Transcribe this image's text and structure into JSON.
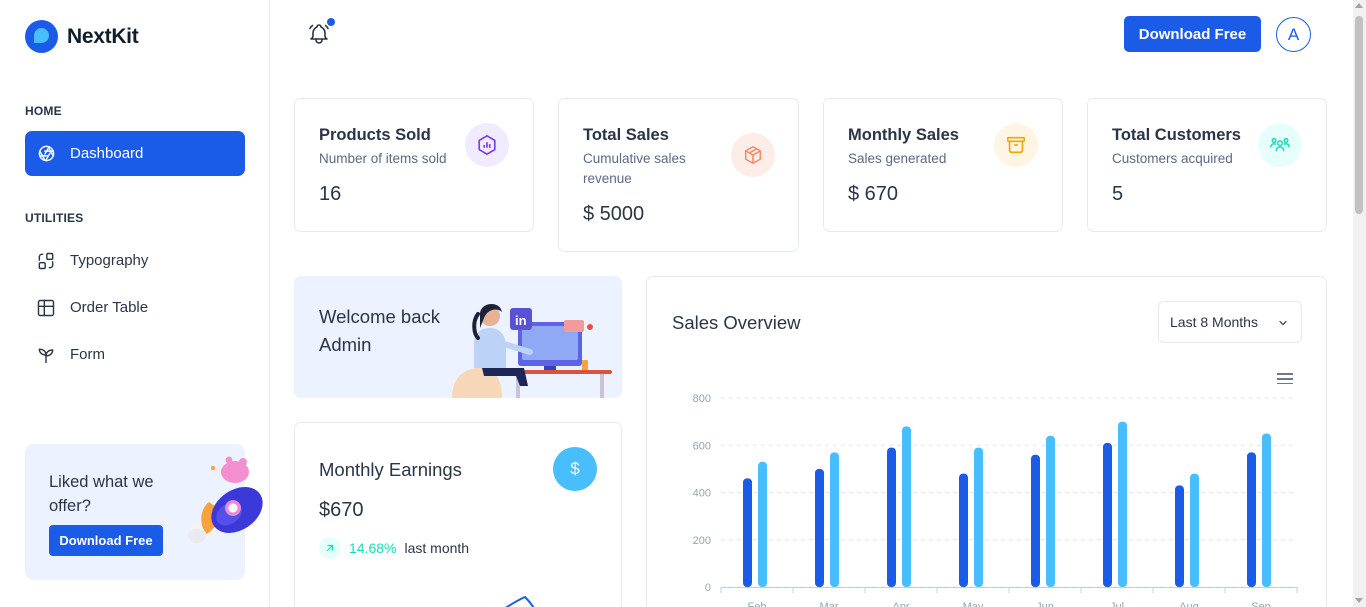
{
  "brand": {
    "name": "NextKit"
  },
  "sidebar": {
    "sections": [
      {
        "caption": "HOME",
        "items": [
          {
            "label": "Dashboard",
            "icon": "aperture-icon",
            "active": true
          }
        ]
      },
      {
        "caption": "UTILITIES",
        "items": [
          {
            "label": "Typography",
            "icon": "typography-icon"
          },
          {
            "label": "Order Table",
            "icon": "table-icon"
          },
          {
            "label": "Form",
            "icon": "plant-icon"
          }
        ]
      }
    ],
    "promo": {
      "title": "Liked what we offer?",
      "button": "Download Free"
    }
  },
  "header": {
    "download_button": "Download Free",
    "avatar_initial": "A",
    "notification_icon": "bell-icon"
  },
  "stats": [
    {
      "title": "Products Sold",
      "subtitle": "Number of items sold",
      "value": "16",
      "icon": "chart-bar-icon",
      "icon_color": "#7c3aed",
      "icon_bg": "#f1ebff"
    },
    {
      "title": "Total Sales",
      "subtitle": "Cumulative sales revenue",
      "value": "$ 5000",
      "icon": "box-icon",
      "icon_color": "#fa896b",
      "icon_bg": "#fdede8"
    },
    {
      "title": "Monthly Sales",
      "subtitle": "Sales generated",
      "value": "$ 670",
      "icon": "archive-icon",
      "icon_color": "#f0a500",
      "icon_bg": "#fef5e5"
    },
    {
      "title": "Total Customers",
      "subtitle": "Customers acquired",
      "value": "5",
      "icon": "users-icon",
      "icon_color": "#13deb9",
      "icon_bg": "#e6fffa"
    }
  ],
  "welcome": {
    "text": "Welcome back Admin"
  },
  "earnings": {
    "title": "Monthly Earnings",
    "value": "$670",
    "change": "14.68%",
    "period": "last month",
    "icon": "dollar-icon"
  },
  "sales_overview": {
    "title": "Sales Overview",
    "selected_range": "Last 8 Months",
    "menu_icon": "hamburger-menu-icon"
  },
  "colors": {
    "primary": "#1a5be8",
    "secondary": "#49beff",
    "success": "#13deb9"
  },
  "chart_data": {
    "type": "bar",
    "categories": [
      "Feb",
      "Mar",
      "Apr",
      "May",
      "Jun",
      "Jul",
      "Aug",
      "Sep"
    ],
    "series": [
      {
        "values": [
          460,
          500,
          590,
          480,
          560,
          610,
          430,
          570
        ],
        "color": "#1a5be8"
      },
      {
        "values": [
          530,
          570,
          680,
          590,
          640,
          700,
          480,
          650
        ],
        "color": "#49beff"
      }
    ],
    "yticks": [
      0,
      200,
      400,
      600,
      800
    ],
    "ylim": [
      0,
      800
    ],
    "grid": true,
    "title": "Sales Overview"
  }
}
